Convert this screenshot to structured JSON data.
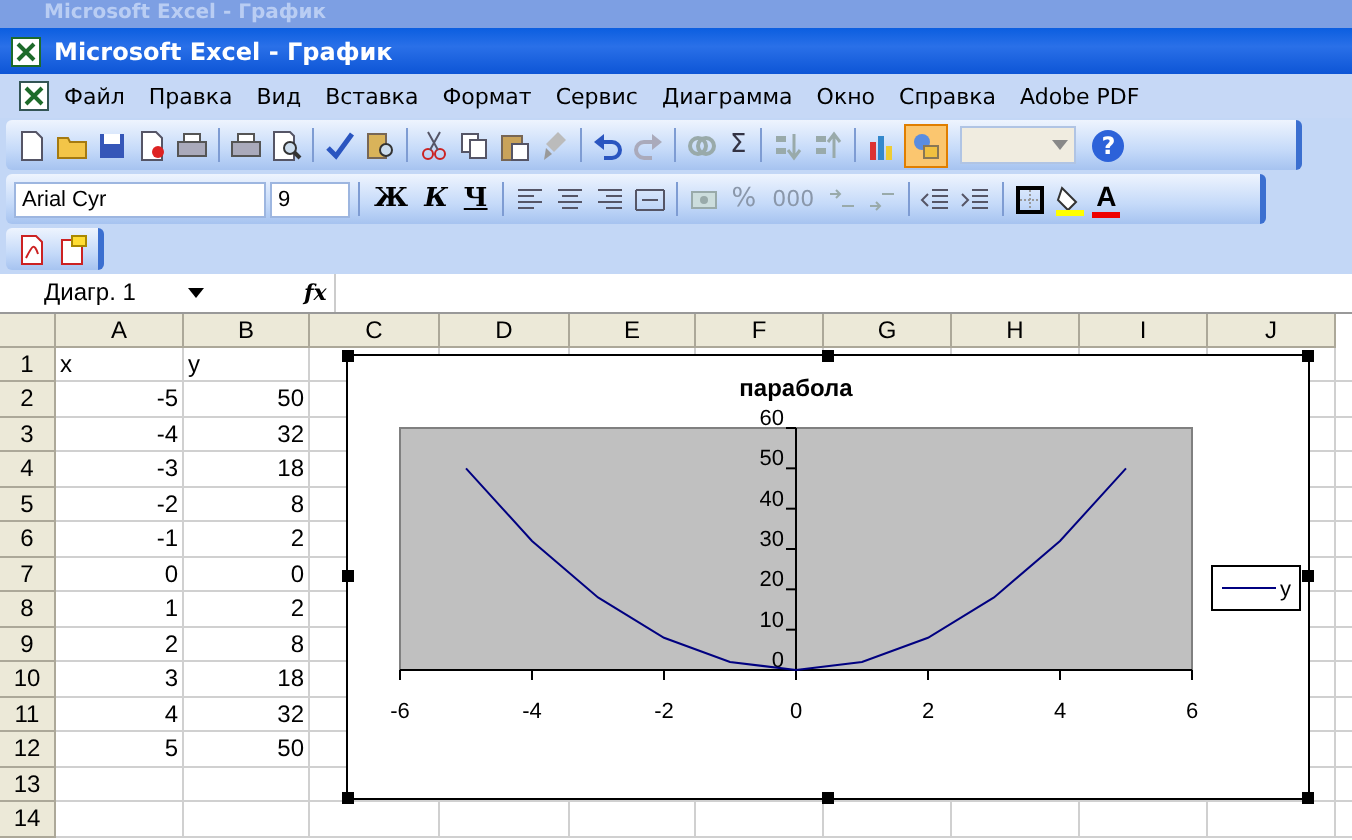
{
  "back_window": {
    "title": "Microsoft Excel - График"
  },
  "window": {
    "title": "Microsoft Excel - График"
  },
  "menu": [
    "Файл",
    "Правка",
    "Вид",
    "Вставка",
    "Формат",
    "Сервис",
    "Диаграмма",
    "Окно",
    "Справка",
    "Adobe PDF"
  ],
  "standard_toolbar": {
    "sum_label": "Σ",
    "drawing_on": true,
    "help_label": "?"
  },
  "formatting_toolbar": {
    "font": "Arial Cyr",
    "size": "9",
    "style_buttons": [
      "Ж",
      "К",
      "Ч"
    ],
    "percent": "%",
    "thousands": "000",
    "font_color_label": "A"
  },
  "formula_bar": {
    "name_box": "Диагр. 1",
    "fx_label": "fx"
  },
  "sheet": {
    "columns": [
      "A",
      "B",
      "C",
      "D",
      "E",
      "F",
      "G",
      "H",
      "I",
      "J"
    ],
    "rows": [
      {
        "number": "1",
        "cells": [
          "x",
          "y"
        ]
      },
      {
        "number": "2",
        "cells": [
          "-5",
          "50"
        ]
      },
      {
        "number": "3",
        "cells": [
          "-4",
          "32"
        ]
      },
      {
        "number": "4",
        "cells": [
          "-3",
          "18"
        ]
      },
      {
        "number": "5",
        "cells": [
          "-2",
          "8"
        ]
      },
      {
        "number": "6",
        "cells": [
          "-1",
          "2"
        ]
      },
      {
        "number": "7",
        "cells": [
          "0",
          "0"
        ]
      },
      {
        "number": "8",
        "cells": [
          "1",
          "2"
        ]
      },
      {
        "number": "9",
        "cells": [
          "2",
          "8"
        ]
      },
      {
        "number": "10",
        "cells": [
          "3",
          "18"
        ]
      },
      {
        "number": "11",
        "cells": [
          "4",
          "32"
        ]
      },
      {
        "number": "12",
        "cells": [
          "5",
          "50"
        ]
      },
      {
        "number": "13"
      },
      {
        "number": "14"
      }
    ]
  },
  "chart": {
    "selected": true,
    "chart_data": {
      "type": "line",
      "title": "парабола",
      "x": [
        -5,
        -4,
        -3,
        -2,
        -1,
        0,
        1,
        2,
        3,
        4,
        5
      ],
      "series": [
        {
          "name": "y",
          "color": "#000080",
          "values": [
            50,
            32,
            18,
            8,
            2,
            0,
            2,
            8,
            18,
            32,
            50
          ]
        }
      ],
      "xlim": [
        -6,
        6
      ],
      "ylim": [
        0,
        60
      ],
      "xticks": [
        -6,
        -4,
        -2,
        0,
        2,
        4,
        6
      ],
      "yticks": [
        0,
        10,
        20,
        30,
        40,
        50,
        60
      ]
    }
  }
}
